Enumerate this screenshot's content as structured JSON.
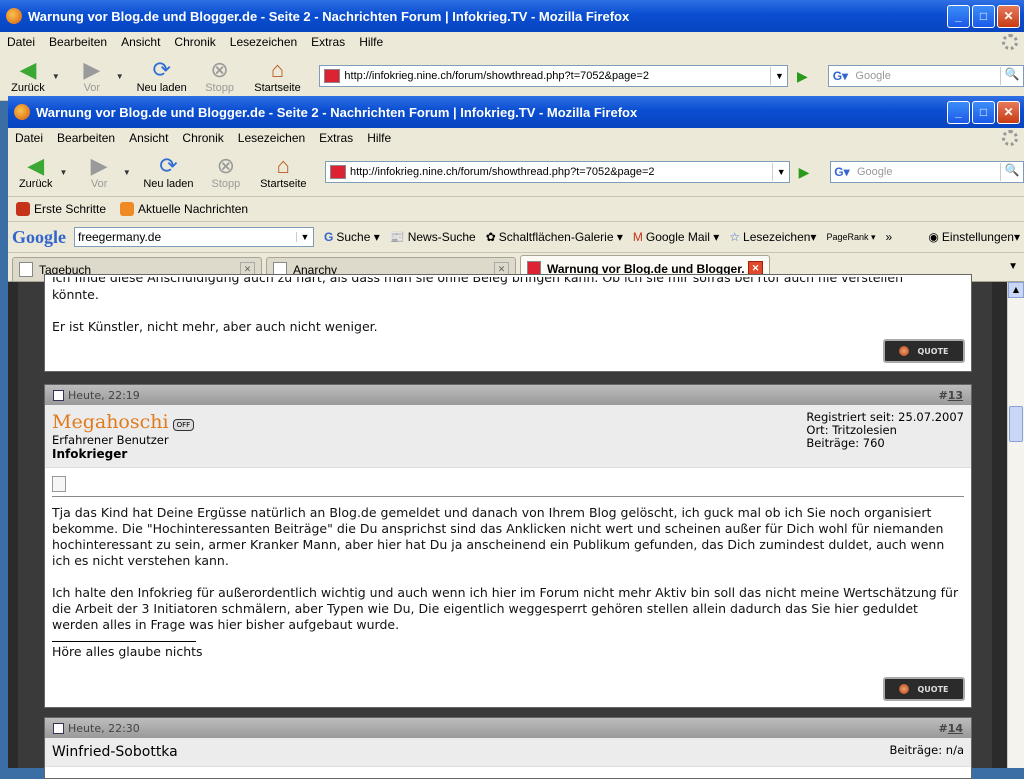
{
  "window": {
    "title": "Warnung vor Blog.de und Blogger.de - Seite 2 - Nachrichten Forum | Infokrieg.TV - Mozilla Firefox"
  },
  "menu": [
    "Datei",
    "Bearbeiten",
    "Ansicht",
    "Chronik",
    "Lesezeichen",
    "Extras",
    "Hilfe"
  ],
  "nav": {
    "back": "Zurück",
    "forward": "Vor",
    "reload": "Neu laden",
    "stop": "Stopp",
    "home": "Startseite",
    "url": "http://infokrieg.nine.ch/forum/showthread.php?t=7052&page=2",
    "search_placeholder": "Google"
  },
  "bookmarks": [
    "Erste Schritte",
    "Aktuelle Nachrichten"
  ],
  "google_toolbar": {
    "logo": "Google",
    "query": "freegermany.de",
    "items": [
      "Suche",
      "News-Suche",
      "Schaltflächen-Galerie",
      "Google Mail",
      "Lesezeichen",
      "PageRank",
      "»",
      "Einstellungen"
    ]
  },
  "tabs": [
    {
      "label": "Tagebuch"
    },
    {
      "label": "Anarchy"
    },
    {
      "label": "Warnung vor Blog.de und Blogger..."
    }
  ],
  "posts": {
    "prev": {
      "line1": "Ich finde diese Anschuldigung auch zu hart, als dass man sie ohne Beleg bringen kann. Ob ich sie mir sofras bei rtof auch nie verstellen",
      "line2": "könnte.",
      "line3": "Er ist Künstler, nicht mehr, aber auch nicht weniger.",
      "quote": "QUOTE"
    },
    "p13": {
      "date": "Heute, 22:19",
      "num_prefix": "#",
      "num": "13",
      "username": "Megahoschi",
      "status": "OFF",
      "title": "Erfahrener Benutzer",
      "rank": "Infokrieger",
      "registered": "Registriert seit: 25.07.2007",
      "location": "Ort: Tritzolesien",
      "posts": "Beiträge: 760",
      "para1": "Tja das Kind hat Deine Ergüsse natürlich an Blog.de gemeldet und danach von Ihrem Blog gelöscht, ich guck mal ob ich Sie noch organisiert bekomme. Die \"Hochinteressanten Beiträge\" die Du ansprichst sind das Anklicken nicht wert und scheinen außer für Dich wohl für niemanden hochinteressant zu sein, armer Kranker Mann, aber hier hat Du ja anscheinend ein Publikum gefunden, das Dich zumindest duldet, auch wenn ich es nicht verstehen kann.",
      "para2": "Ich halte den Infokrieg für außerordentlich wichtig und auch wenn ich hier im Forum nicht mehr Aktiv bin soll das nicht meine Wertschätzung für die Arbeit der 3 Initiatoren schmälern, aber Typen wie Du, Die eigentlich weggesperrt gehören stellen allein dadurch das Sie hier geduldet werden alles in Frage was hier bisher aufgebaut wurde.",
      "signature": "Höre alles glaube nichts",
      "quote": "QUOTE"
    },
    "p14": {
      "date": "Heute, 22:30",
      "num_prefix": "#",
      "num": "14",
      "username": "Winfried-Sobottka",
      "posts": "Beiträge: n/a"
    }
  }
}
